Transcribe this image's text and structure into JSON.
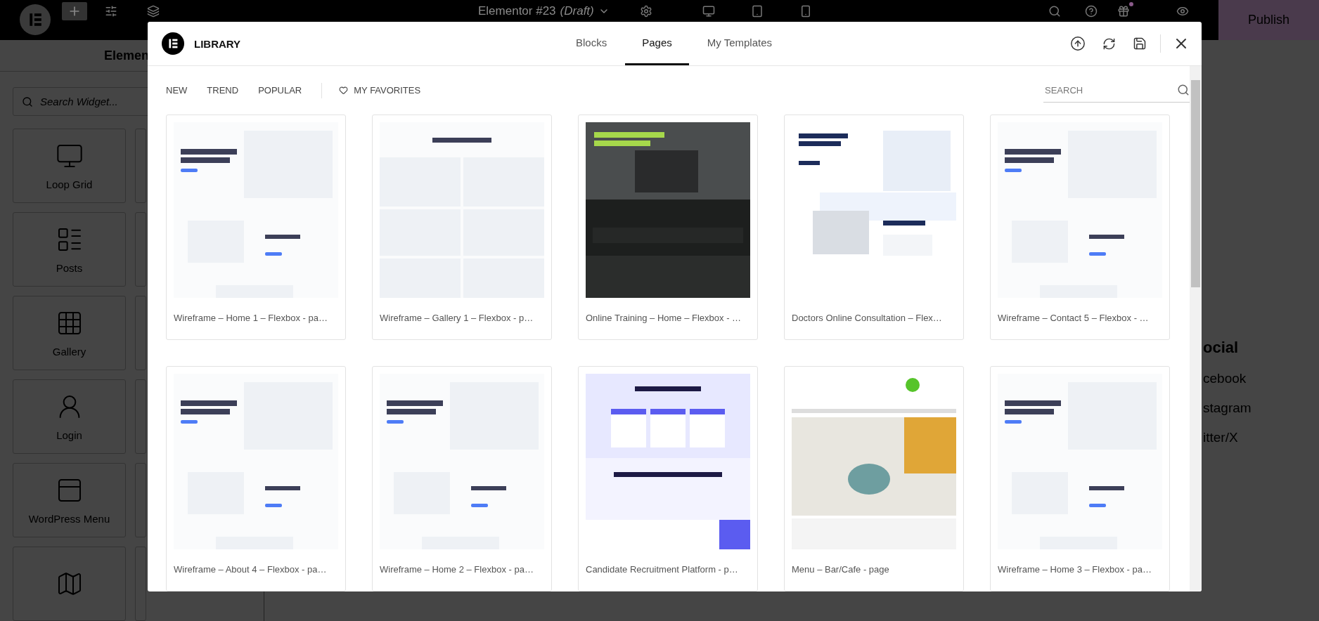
{
  "topbar": {
    "document_title": "Elementor #23",
    "document_status": "(Draft)",
    "publish": "Publish"
  },
  "sidebar": {
    "title": "Elemen",
    "search": {
      "placeholder": "Search Widget..."
    },
    "widgets": [
      "Loop Grid",
      "Posts",
      "Gallery",
      "Login",
      "WordPress Menu"
    ]
  },
  "canvas": {
    "social_heading": "ocial",
    "social_links": [
      "cebook",
      "stagram",
      "itter/X"
    ]
  },
  "library": {
    "title": "LIBRARY",
    "tabs": [
      {
        "label": "Blocks",
        "selected": false
      },
      {
        "label": "Pages",
        "selected": true
      },
      {
        "label": "My Templates",
        "selected": false
      }
    ],
    "filters": [
      "NEW",
      "TREND",
      "POPULAR"
    ],
    "favorites": "MY FAVORITES",
    "search": {
      "placeholder": "SEARCH"
    },
    "templates": [
      {
        "title": "Wireframe – Home 1 – Flexbox - pa…",
        "kind": "wireframe"
      },
      {
        "title": "Wireframe – Gallery 1 – Flexbox - p…",
        "kind": "gallery"
      },
      {
        "title": "Online Training – Home – Flexbox - …",
        "kind": "photo"
      },
      {
        "title": "Doctors Online Consultation – Flex…",
        "kind": "medical"
      },
      {
        "title": "Wireframe – Contact 5 – Flexbox - …",
        "kind": "wireframe"
      },
      {
        "title": "Wireframe – About 4 – Flexbox - pa…",
        "kind": "wireframe"
      },
      {
        "title": "Wireframe – Home 2 – Flexbox - pa…",
        "kind": "wireframe"
      },
      {
        "title": "Candidate Recruitment Platform - p…",
        "kind": "pricing"
      },
      {
        "title": "Menu – Bar/Cafe - page",
        "kind": "cafe"
      },
      {
        "title": "Wireframe – Home 3 – Flexbox - pa…",
        "kind": "wireframe"
      }
    ]
  }
}
